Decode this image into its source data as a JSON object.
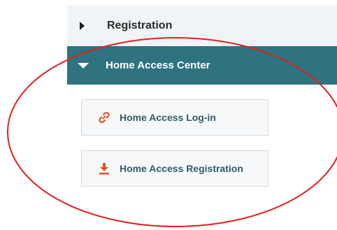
{
  "menu": {
    "registration": {
      "label": "Registration",
      "icon": "caret-right-icon",
      "expanded": false
    },
    "home_access_center": {
      "label": "Home Access Center",
      "icon": "caret-down-icon",
      "expanded": true,
      "background": "#2f7381"
    }
  },
  "submenu": {
    "items": [
      {
        "label": "Home Access Log-in",
        "icon": "link-icon",
        "icon_color": "#d9551f"
      },
      {
        "label": "Home Access Registration",
        "icon": "download-icon",
        "icon_color": "#d9551f"
      }
    ]
  },
  "annotation": {
    "shape": "ellipse",
    "color": "#e0201c"
  }
}
